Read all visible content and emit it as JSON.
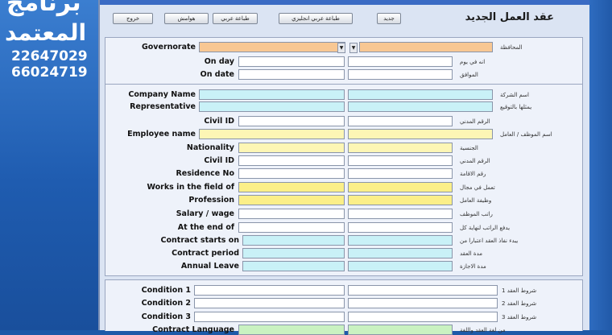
{
  "promo": {
    "line1": "برنامج",
    "line2": "المعتمد",
    "phone1": "22647029",
    "phone2": "66024719"
  },
  "toolbar": {
    "exit": "خروج",
    "footnotes": "هوامش",
    "print_ar": "طباعة عربي",
    "print_ar_en": "طباعة عربي انجليزي",
    "new": "جديد"
  },
  "form_title": "عقد العمل الجديد",
  "section1": {
    "governorate_en": "Governorate",
    "governorate_ar": "المحافظة",
    "on_day_en": "On day",
    "on_day_ar": "انه في يوم",
    "on_date_en": "On date",
    "on_date_ar": "الموافق"
  },
  "section2": {
    "company_en": "Company Name",
    "company_ar": "اسم الشركة",
    "rep_en": "Representative",
    "rep_ar": "يمثلها بالتوقيع",
    "civil1_en": "Civil ID",
    "civil1_ar": "الرقم المدني",
    "employee_en": "Employee name",
    "employee_ar": "اسم الموظف / العامل",
    "nationality_en": "Nationality",
    "nationality_ar": "الجنسية",
    "civil2_en": "Civil ID",
    "civil2_ar": "الرقم المدني",
    "residence_en": "Residence No",
    "residence_ar": "رقم الاقامة",
    "works_en": "Works in the field of",
    "works_ar": "تعمل في مجال",
    "profession_en": "Profession",
    "profession_ar": "وظيفة العامل",
    "salary_en": "Salary / wage",
    "salary_ar": "راتب الموظف",
    "atend_en": "At the end of",
    "atend_ar": "يدفع الراتب لنهاية كل",
    "starts_en": "Contract starts on",
    "starts_ar": "يبدء نفاذ العقد اعتبارا من",
    "period_en": "Contract period",
    "period_ar": "مدة العقد",
    "leave_en": "Annual Leave",
    "leave_ar": "مدة الاجازة"
  },
  "section3": {
    "c1_en": "Condition 1",
    "c1_ar": "شروط العقد 1",
    "c2_en": "Condition 2",
    "c2_ar": "شروط العقد 2",
    "c3_en": "Condition 3",
    "c3_ar": "شروط العقد 3",
    "lang_en": "Contract Language",
    "lang_ar": "من لغة العقد واللغة"
  }
}
